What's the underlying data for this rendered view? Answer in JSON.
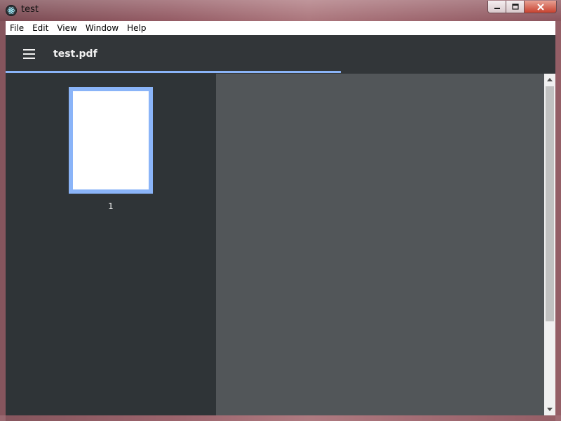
{
  "window": {
    "title": "test"
  },
  "menu": {
    "items": [
      "File",
      "Edit",
      "View",
      "Window",
      "Help"
    ]
  },
  "toolbar": {
    "doc_title": "test.pdf"
  },
  "load_progress": 0.61,
  "sidebar": {
    "thumbnails": [
      {
        "page_label": "1"
      }
    ]
  },
  "colors": {
    "toolbar_bg": "#323639",
    "sidebar_bg": "#2f3437",
    "viewer_bg": "#525659",
    "accent": "#8ab4f8"
  }
}
